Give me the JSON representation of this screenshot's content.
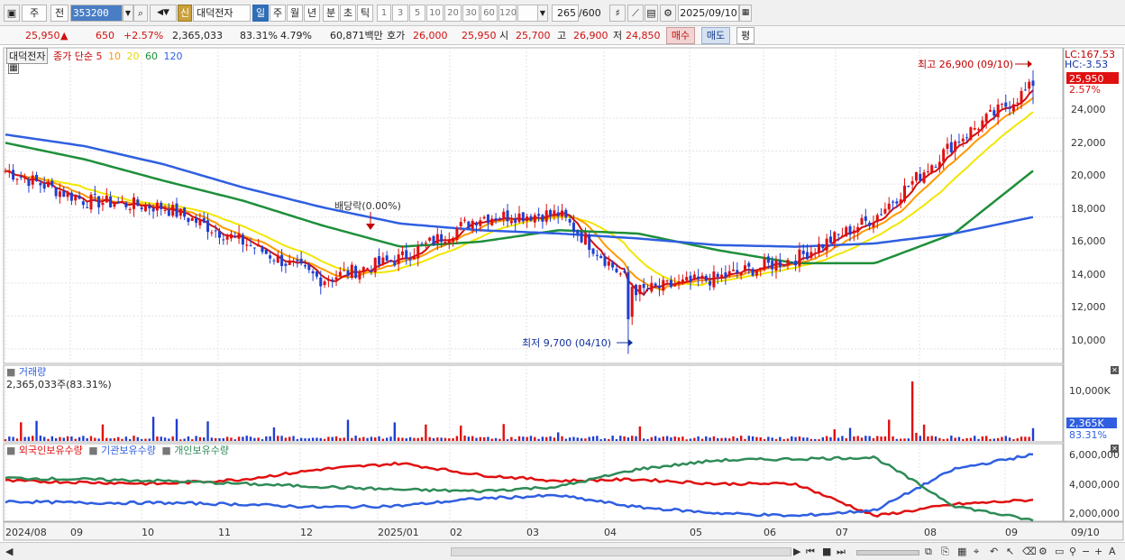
{
  "toolbar": {
    "market": "주",
    "prev_label": "전",
    "code": "353200",
    "name_badge": "신",
    "stock_name": "대덕전자",
    "periods": [
      "일",
      "주",
      "월",
      "년",
      "분",
      "초",
      "틱"
    ],
    "active_period": "일",
    "intervals": [
      "1",
      "3",
      "5",
      "10",
      "20",
      "30",
      "60",
      "120"
    ],
    "count_value": "265",
    "count_total": "/600",
    "date_value": "2025/09/10"
  },
  "quote": {
    "price": "25,950",
    "change": "650",
    "change_pct": "+2.57%",
    "volume": "2,365,033",
    "volume_ratio": "83.31%",
    "turnover_rate": "4.79%",
    "amount": "60,871백만",
    "ask_label": "호가",
    "ask": "26,000",
    "bid": "25,950",
    "open_label": "시",
    "open": "25,700",
    "high_label": "고",
    "high": "26,900",
    "low_label": "저",
    "low": "24,850",
    "buy_label": "매수",
    "sell_label": "매도",
    "flat_label": "평"
  },
  "price_panel": {
    "stock_label": "대덕전자",
    "indicator_label": "종가 단순",
    "ma_periods": [
      "5",
      "10",
      "20",
      "60",
      "120"
    ],
    "ma_colors": [
      "#d01010",
      "#ff9900",
      "#f2e600",
      "#1e8f3a",
      "#2f5fe0"
    ],
    "lc_label": "LC:167.53",
    "hc_label": "HC:-3.53",
    "current_price_tag": "25,950",
    "current_change_tag": "2.57%",
    "high_annotation": "최고 26,900 (09/10)",
    "low_annotation": "최저 9,700 (04/10)",
    "dividend_annotation": "배당락(0.00%)",
    "y_ticks": [
      "24,000",
      "22,000",
      "20,000",
      "18,000",
      "16,000",
      "14,000",
      "12,000",
      "10,000"
    ]
  },
  "volume_panel": {
    "title": "거래량",
    "value_label": "2,365,033주(83.31%)",
    "y_tick": "10,000K",
    "current_tag": "2,365K",
    "current_pct": "83.31%"
  },
  "holding_panel": {
    "series_labels": [
      "외국인보유수량",
      "기관보유수량",
      "개인보유수량"
    ],
    "series_colors": [
      "#e01010",
      "#2f5fe0",
      "#2e8b57"
    ],
    "y_ticks": [
      "6,000,000",
      "4,000,000",
      "2,000,000"
    ]
  },
  "x_axis": {
    "labels": [
      "2024/08",
      "09",
      "10",
      "11",
      "12",
      "2025/01",
      "02",
      "03",
      "04",
      "05",
      "06",
      "07",
      "08",
      "09"
    ],
    "right_label": "09/10"
  },
  "chart_data": [
    {
      "type": "candlestick",
      "title": "대덕전자 일봉",
      "x_range": [
        "2024/08",
        "2025/09/10"
      ],
      "y_range": [
        9700,
        26900
      ],
      "key_points": [
        {
          "label": "최고",
          "date": "09/10",
          "value": 26900
        },
        {
          "label": "최저",
          "date": "04/10",
          "value": 9700
        }
      ],
      "close_trajectory": [
        {
          "month": "2024/08",
          "value": 20800
        },
        {
          "month": "09",
          "value": 19000
        },
        {
          "month": "10",
          "value": 18600
        },
        {
          "month": "11",
          "value": 16500
        },
        {
          "month": "12",
          "value": 14200
        },
        {
          "month": "2025/01",
          "value": 15500
        },
        {
          "month": "02",
          "value": 18000
        },
        {
          "month": "03",
          "value": 18200
        },
        {
          "month": "04",
          "value": 13500
        },
        {
          "month": "05",
          "value": 14300
        },
        {
          "month": "06",
          "value": 15500
        },
        {
          "month": "07",
          "value": 18000
        },
        {
          "month": "08",
          "value": 22500
        },
        {
          "month": "09",
          "value": 25950
        }
      ],
      "ma_trajectories": {
        "120": [
          23000,
          22300,
          21200,
          19800,
          18600,
          17600,
          17200,
          17000,
          16700,
          16300,
          16200,
          16400,
          17000,
          18000
        ],
        "60": [
          22500,
          21500,
          20200,
          19000,
          17500,
          16200,
          16500,
          17200,
          17000,
          16000,
          15200,
          15200,
          17000,
          20800
        ]
      }
    },
    {
      "type": "bar",
      "title": "거래량",
      "current_value": 2365033,
      "ylim": [
        0,
        12000000
      ],
      "notable_peaks": [
        {
          "month": "08",
          "value": 11000000
        }
      ]
    },
    {
      "type": "line",
      "title": "보유수량",
      "series": [
        {
          "name": "외국인보유수량",
          "start": 4200000,
          "end": 2900000
        },
        {
          "name": "기관보유수량",
          "start": 2800000,
          "end": 6000000
        },
        {
          "name": "개인보유수량",
          "start": 4400000,
          "end": 1500000
        }
      ],
      "ylim": [
        1200000,
        6500000
      ]
    }
  ]
}
